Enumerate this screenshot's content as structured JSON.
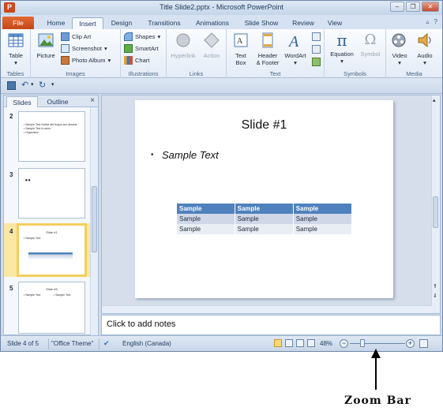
{
  "window": {
    "title": "Title Slide2.pptx - Microsoft PowerPoint",
    "app_letter": "P"
  },
  "tabs": [
    {
      "label": "File"
    },
    {
      "label": "Home"
    },
    {
      "label": "Insert"
    },
    {
      "label": "Design"
    },
    {
      "label": "Transitions"
    },
    {
      "label": "Animations"
    },
    {
      "label": "Slide Show"
    },
    {
      "label": "Review"
    },
    {
      "label": "View"
    }
  ],
  "active_tab": "Insert",
  "ribbon": {
    "groups": {
      "tables": {
        "label": "Tables",
        "table": "Table"
      },
      "images": {
        "label": "Images",
        "picture": "Picture",
        "clip_art": "Clip Art",
        "screenshot": "Screenshot",
        "photo_album": "Photo Album"
      },
      "illustrations": {
        "label": "Illustrations",
        "shapes": "Shapes",
        "smartart": "SmartArt",
        "chart": "Chart"
      },
      "links": {
        "label": "Links",
        "hyperlink": "Hyperlink",
        "action": "Action"
      },
      "text": {
        "label": "Text",
        "text_box_1": "Text",
        "text_box_2": "Box",
        "header_1": "Header",
        "header_2": "& Footer",
        "wordart": "WordArt"
      },
      "symbols": {
        "label": "Symbols",
        "equation": "Equation",
        "symbol": "Symbol"
      },
      "media": {
        "label": "Media",
        "video": "Video",
        "audio": "Audio"
      }
    }
  },
  "left_pane": {
    "tabs": [
      "Slides",
      "Outline"
    ],
    "close": "×",
    "thumbs": [
      {
        "num": "2",
        "lines": [
          "• Sample Text Notice abt bogus axo abstest",
          "• Sample Text hi arms",
          "• Organised"
        ]
      },
      {
        "num": "3",
        "lines": [
          ":●●"
        ]
      },
      {
        "num": "4",
        "title": "Slide #1",
        "lines": [
          "• Sample Text"
        ]
      },
      {
        "num": "5",
        "title": "Slide #5",
        "lines": [
          "• Sample Text",
          "• Sample Text"
        ]
      }
    ]
  },
  "slide": {
    "title": "Slide #1",
    "bullet": "Sample Text",
    "table": {
      "header": [
        "Sample",
        "Sample",
        "Sample"
      ],
      "rows": [
        [
          "Sample",
          "Sample",
          "Sample"
        ],
        [
          "Sample",
          "Sample",
          "Sample"
        ]
      ]
    }
  },
  "notes": {
    "placeholder": "Click to add notes"
  },
  "status": {
    "slide_info": "Slide 4 of 5",
    "theme": "\"Office Theme\"",
    "language": "English (Canada)",
    "zoom": "48%",
    "zoom_minus": "−",
    "zoom_plus": "+"
  },
  "annotation": {
    "text": "Zoom Bar"
  }
}
